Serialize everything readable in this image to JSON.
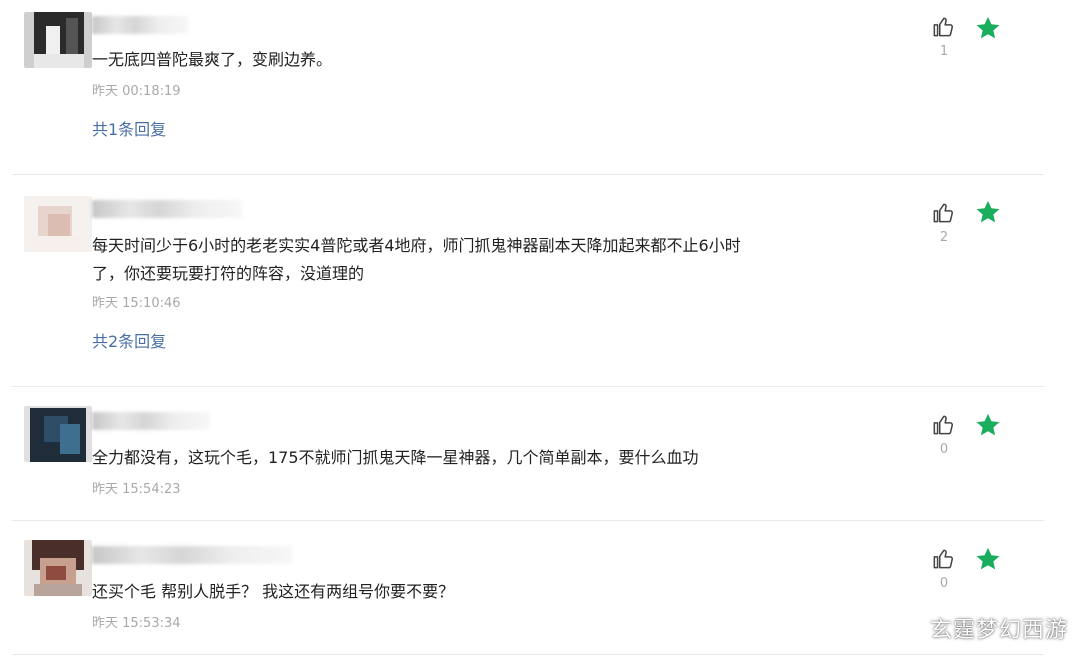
{
  "comments": [
    {
      "text_lines": [
        "一无底四普陀最爽了，变刷边养。"
      ],
      "time": "昨天 00:18:19",
      "replies": "共1条回复",
      "likes": "1"
    },
    {
      "text_lines": [
        "每天时间少于6小时的老老实实4普陀或者4地府，师门抓鬼神器副本天降加起来都不止6小时",
        "了，你还要玩要打符的阵容，没道理的"
      ],
      "time": "昨天 15:10:46",
      "replies": "共2条回复",
      "likes": "2"
    },
    {
      "text_lines": [
        "全力都没有，这玩个毛，175不就师门抓鬼天降一星神器，几个简单副本，要什么血功"
      ],
      "time": "昨天 15:54:23",
      "likes": "0"
    },
    {
      "text_lines": [
        "还买个毛  帮别人脱手？  我这还有两组号你要不要？"
      ],
      "time": "昨天 15:53:34",
      "likes": "0"
    }
  ],
  "icons": {
    "like": "thumbs-up-icon",
    "favorite": "star-icon"
  },
  "colors": {
    "star": "#1aad5e",
    "reply_link": "#4a6fa5",
    "muted": "#a9a9a9"
  },
  "watermark": "玄霆梦幻西游"
}
